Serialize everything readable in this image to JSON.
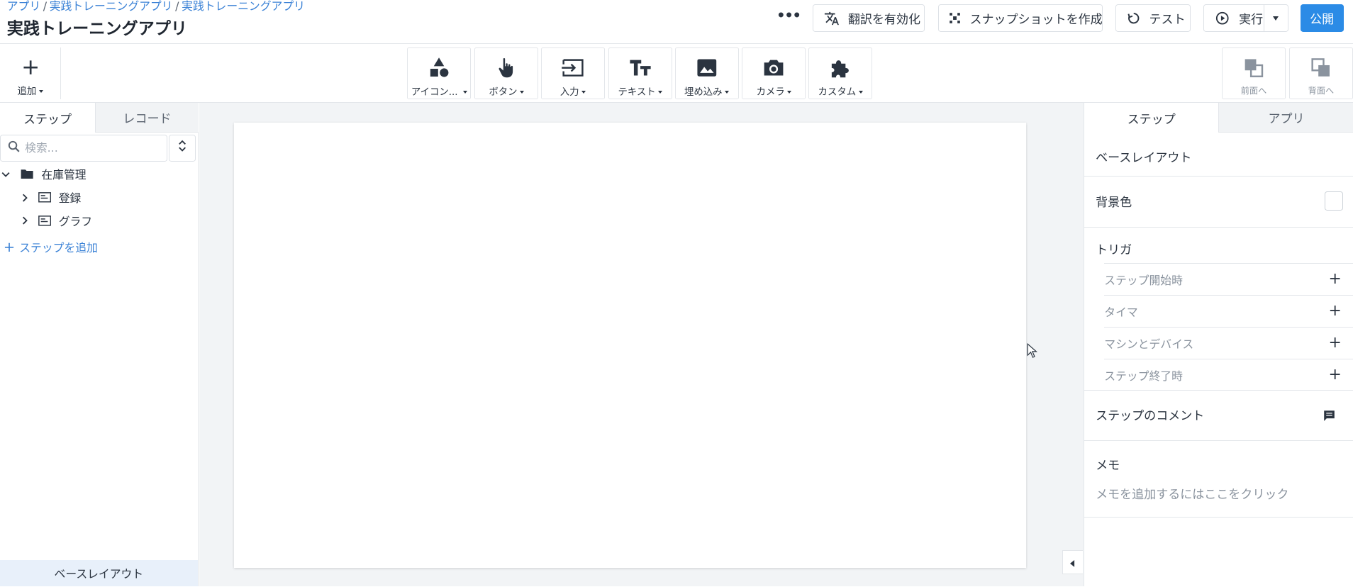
{
  "header": {
    "breadcrumb": [
      "アプリ",
      "実践トレーニングアプリ",
      "実践トレーニングアプリ"
    ],
    "breadcrumb_sep": "/",
    "title": "実践トレーニングアプリ",
    "more": "•••",
    "translate_label": "翻訳を有効化",
    "snapshot_label": "スナップショットを作成",
    "test_label": "テスト",
    "run_label": "実行",
    "publish_label": "公開"
  },
  "toolbar": {
    "add_label": "追加",
    "widgets": [
      {
        "label": "アイコン...",
        "icon": "shapes-icon"
      },
      {
        "label": "ボタン",
        "icon": "pointer-hand-icon"
      },
      {
        "label": "入力",
        "icon": "input-icon"
      },
      {
        "label": "テキスト",
        "icon": "text-icon"
      },
      {
        "label": "埋め込み",
        "icon": "image-icon"
      },
      {
        "label": "カメラ",
        "icon": "camera-icon"
      },
      {
        "label": "カスタム",
        "icon": "puzzle-icon"
      }
    ],
    "bring_front_label": "前面へ",
    "send_back_label": "背面へ"
  },
  "left_panel": {
    "tabs": [
      "ステップ",
      "レコード"
    ],
    "search_placeholder": "検索...",
    "tree": [
      {
        "label": "在庫管理",
        "type": "folder",
        "expanded": true
      },
      {
        "label": "登録",
        "type": "step",
        "expanded": false
      },
      {
        "label": "グラフ",
        "type": "step",
        "expanded": false
      }
    ],
    "add_step": "ステップを追加",
    "footer": "ベースレイアウト"
  },
  "right_panel": {
    "tabs": [
      "ステップ",
      "アプリ"
    ],
    "base_layout": "ベースレイアウト",
    "background_color_label": "背景色",
    "background_color": "#ffffff",
    "triggers_label": "トリガ",
    "triggers": [
      "ステップ開始時",
      "タイマ",
      "マシンとデバイス",
      "ステップ終了時"
    ],
    "comments_label": "ステップのコメント",
    "memo_label": "メモ",
    "memo_hint": "メモを追加するにはここをクリック"
  },
  "colors": {
    "accent": "#2b8be6",
    "link": "#3b82d6",
    "canvas_bg": "#f2f4f6",
    "selected_bg": "#e8f0fa"
  }
}
